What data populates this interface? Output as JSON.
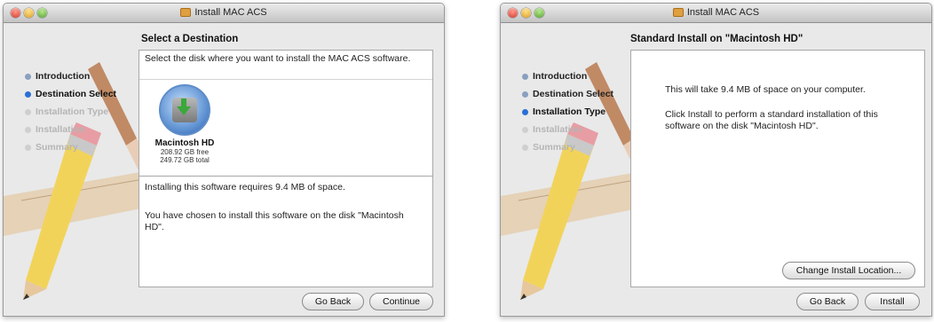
{
  "window1": {
    "title": "Install MAC ACS",
    "steps": [
      {
        "label": "Introduction",
        "state": "done"
      },
      {
        "label": "Destination Select",
        "state": "current"
      },
      {
        "label": "Installation Type",
        "state": "future"
      },
      {
        "label": "Installation",
        "state": "future"
      },
      {
        "label": "Summary",
        "state": "future"
      }
    ],
    "pane_title": "Select a Destination",
    "instruction": "Select the disk where you want to install the MAC ACS software.",
    "disk": {
      "name": "Macintosh HD",
      "free": "208.92 GB free",
      "total": "249.72 GB total"
    },
    "info_line1": "Installing this software requires 9.4 MB of space.",
    "info_line2": "You have chosen to install this software on the disk \"Macintosh HD\".",
    "back_button": "Go Back",
    "continue_button": "Continue"
  },
  "window2": {
    "title": "Install MAC ACS",
    "steps": [
      {
        "label": "Introduction",
        "state": "done"
      },
      {
        "label": "Destination Select",
        "state": "done"
      },
      {
        "label": "Installation Type",
        "state": "current"
      },
      {
        "label": "Installation",
        "state": "future"
      },
      {
        "label": "Summary",
        "state": "future"
      }
    ],
    "pane_title": "Standard Install on \"Macintosh HD\"",
    "space_text": "This will take 9.4 MB of space on your computer.",
    "install_text": "Click Install to perform a standard installation of this software on the disk \"Macintosh HD\".",
    "change_location_button": "Change Install Location...",
    "back_button": "Go Back",
    "install_button": "Install"
  }
}
